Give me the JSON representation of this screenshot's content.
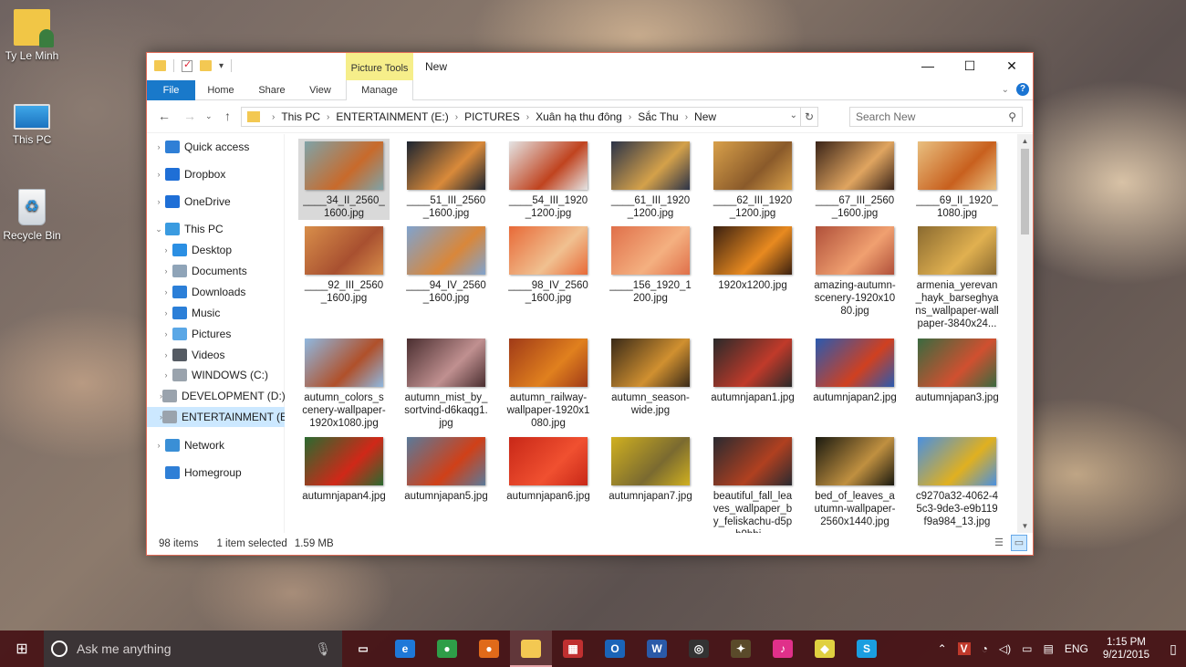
{
  "desktop": {
    "icons": [
      {
        "label": "Ty Le Minh",
        "icon": "user-folder"
      },
      {
        "label": "This PC",
        "icon": "monitor"
      },
      {
        "label": "Recycle Bin",
        "icon": "recycle-bin"
      }
    ]
  },
  "window": {
    "contextual_tab": "Picture Tools",
    "title": "New",
    "controls": {
      "minimize": "—",
      "maximize": "☐",
      "close": "✕"
    }
  },
  "ribbon": {
    "tabs": [
      "File",
      "Home",
      "Share",
      "View",
      "Manage"
    ]
  },
  "address": {
    "crumbs": [
      "This PC",
      "ENTERTAINMENT (E:)",
      "PICTURES",
      "Xuân hạ thu đông",
      "Sắc Thu",
      "New"
    ],
    "search_placeholder": "Search New"
  },
  "navpane": {
    "items": [
      {
        "label": "Quick access",
        "icon": "star",
        "color": "#2f7fd6",
        "level": 0
      },
      {
        "label": "Dropbox",
        "icon": "dropbox",
        "color": "#1f6fd6",
        "level": 0
      },
      {
        "label": "OneDrive",
        "icon": "cloud",
        "color": "#1f6fd6",
        "level": 0
      },
      {
        "label": "This PC",
        "icon": "monitor",
        "color": "#3a9be0",
        "level": 0,
        "expanded": true
      },
      {
        "label": "Desktop",
        "icon": "desktop",
        "color": "#2b8fe3",
        "level": 1
      },
      {
        "label": "Documents",
        "icon": "documents",
        "color": "#8fa4b8",
        "level": 1
      },
      {
        "label": "Downloads",
        "icon": "download",
        "color": "#2b7fd8",
        "level": 1
      },
      {
        "label": "Music",
        "icon": "music",
        "color": "#2b7fd8",
        "level": 1
      },
      {
        "label": "Pictures",
        "icon": "pictures",
        "color": "#5aa7e6",
        "level": 1
      },
      {
        "label": "Videos",
        "icon": "videos",
        "color": "#555b63",
        "level": 1
      },
      {
        "label": "WINDOWS (C:)",
        "icon": "drive",
        "color": "#9aa3ad",
        "level": 1
      },
      {
        "label": "DEVELOPMENT (D:)",
        "icon": "drive",
        "color": "#9aa3ad",
        "level": 1
      },
      {
        "label": "ENTERTAINMENT (E:",
        "icon": "drive",
        "color": "#9aa3ad",
        "level": 1,
        "selected": true
      },
      {
        "label": "Network",
        "icon": "network",
        "color": "#3a8fd6",
        "level": 0
      },
      {
        "label": "Homegroup",
        "icon": "homegroup",
        "color": "#2f7fd6",
        "level": 0
      }
    ]
  },
  "files": [
    {
      "name": "____34_II_2560_1600.jpg",
      "colors": [
        "#7fa3a8",
        "#c86a2b"
      ],
      "selected": true
    },
    {
      "name": "____51_III_2560_1600.jpg",
      "colors": [
        "#1c2430",
        "#d98a3a"
      ]
    },
    {
      "name": "____54_III_1920_1200.jpg",
      "colors": [
        "#e4e4e4",
        "#c0431f"
      ]
    },
    {
      "name": "____61_III_1920_1200.jpg",
      "colors": [
        "#2c3348",
        "#d4a14a"
      ]
    },
    {
      "name": "____62_III_1920_1200.jpg",
      "colors": [
        "#d8a04a",
        "#8a5a2a"
      ]
    },
    {
      "name": "____67_III_2560_1600.jpg",
      "colors": [
        "#3a2418",
        "#e0a560"
      ]
    },
    {
      "name": "____69_II_1920_1080.jpg",
      "colors": [
        "#e9c080",
        "#c8601e"
      ]
    },
    {
      "name": "____92_III_2560_1600.jpg",
      "colors": [
        "#d88e4a",
        "#a85030"
      ]
    },
    {
      "name": "____94_IV_2560_1600.jpg",
      "colors": [
        "#7fa3cf",
        "#d9873a"
      ]
    },
    {
      "name": "____98_IV_2560_1600.jpg",
      "colors": [
        "#e86a38",
        "#f0c090"
      ]
    },
    {
      "name": "____156_1920_1200.jpg",
      "colors": [
        "#e0704a",
        "#f4b080"
      ]
    },
    {
      "name": "1920x1200.jpg",
      "colors": [
        "#3a2010",
        "#e88a20"
      ]
    },
    {
      "name": "amazing-autumn-scenery-1920x1080.jpg",
      "colors": [
        "#b0503a",
        "#f0a070"
      ]
    },
    {
      "name": "armenia_yerevan_hayk_barseghyans_wallpaper-wallpaper-3840x24...",
      "colors": [
        "#8a6a30",
        "#e0b050"
      ]
    },
    {
      "name": "autumn_colors_scenery-wallpaper-1920x1080.jpg",
      "colors": [
        "#8fb8e0",
        "#b0502a"
      ]
    },
    {
      "name": "autumn_mist_by_sortvind-d6kaqg1.jpg",
      "colors": [
        "#4a2e30",
        "#c09090"
      ]
    },
    {
      "name": "autumn_railway-wallpaper-1920x1080.jpg",
      "colors": [
        "#a03a18",
        "#e0801e"
      ]
    },
    {
      "name": "autumn_season-wide.jpg",
      "colors": [
        "#3a2a18",
        "#d09030"
      ]
    },
    {
      "name": "autumnjapan1.jpg",
      "colors": [
        "#2a2a2a",
        "#c03a2a"
      ]
    },
    {
      "name": "autumnjapan2.jpg",
      "colors": [
        "#2a5ab0",
        "#d04020"
      ]
    },
    {
      "name": "autumnjapan3.jpg",
      "colors": [
        "#3a6a40",
        "#d05030"
      ]
    },
    {
      "name": "autumnjapan4.jpg",
      "colors": [
        "#2a6a30",
        "#d02818"
      ]
    },
    {
      "name": "autumnjapan5.jpg",
      "colors": [
        "#5a7a9a",
        "#d04018"
      ]
    },
    {
      "name": "autumnjapan6.jpg",
      "colors": [
        "#c82818",
        "#f05030"
      ]
    },
    {
      "name": "autumnjapan7.jpg",
      "colors": [
        "#d0b020",
        "#7a6a30"
      ]
    },
    {
      "name": "beautiful_fall_leaves_wallpaper_by_feliskachu-d5ph9bbj...",
      "colors": [
        "#2a2a30",
        "#b04020"
      ]
    },
    {
      "name": "bed_of_leaves_autumn-wallpaper-2560x1440.jpg",
      "colors": [
        "#1a1a10",
        "#c09040"
      ]
    },
    {
      "name": "c9270a32-4062-45c3-9de3-e9b119f9a984_13.jpg",
      "colors": [
        "#4a90e0",
        "#e0b020"
      ]
    }
  ],
  "status": {
    "count": "98 items",
    "selection": "1 item selected",
    "size": "1.59 MB"
  },
  "taskbar": {
    "search_text": "Ask me anything",
    "apps": [
      {
        "name": "task-view",
        "glyph": "▭",
        "color": "transparent"
      },
      {
        "name": "edge",
        "glyph": "e",
        "color": "#1e78d8"
      },
      {
        "name": "chrome",
        "glyph": "●",
        "color": "#2e9e48"
      },
      {
        "name": "firefox",
        "glyph": "●",
        "color": "#e06a1a"
      },
      {
        "name": "file-explorer",
        "glyph": "",
        "color": "#f3c852",
        "active": true
      },
      {
        "name": "network-app",
        "glyph": "▦",
        "color": "#c03030"
      },
      {
        "name": "outlook",
        "glyph": "O",
        "color": "#1a64b8"
      },
      {
        "name": "word",
        "glyph": "W",
        "color": "#2a5aa8"
      },
      {
        "name": "media-app",
        "glyph": "◎",
        "color": "#333333"
      },
      {
        "name": "photo-app",
        "glyph": "✦",
        "color": "#5a4a2a"
      },
      {
        "name": "itunes",
        "glyph": "♪",
        "color": "#e0308a"
      },
      {
        "name": "gallery-app",
        "glyph": "◆",
        "color": "#e0d040"
      },
      {
        "name": "skype",
        "glyph": "S",
        "color": "#1a9ee0"
      }
    ],
    "tray": {
      "lang": "ENG",
      "time": "1:15 PM",
      "date": "9/21/2015"
    }
  }
}
